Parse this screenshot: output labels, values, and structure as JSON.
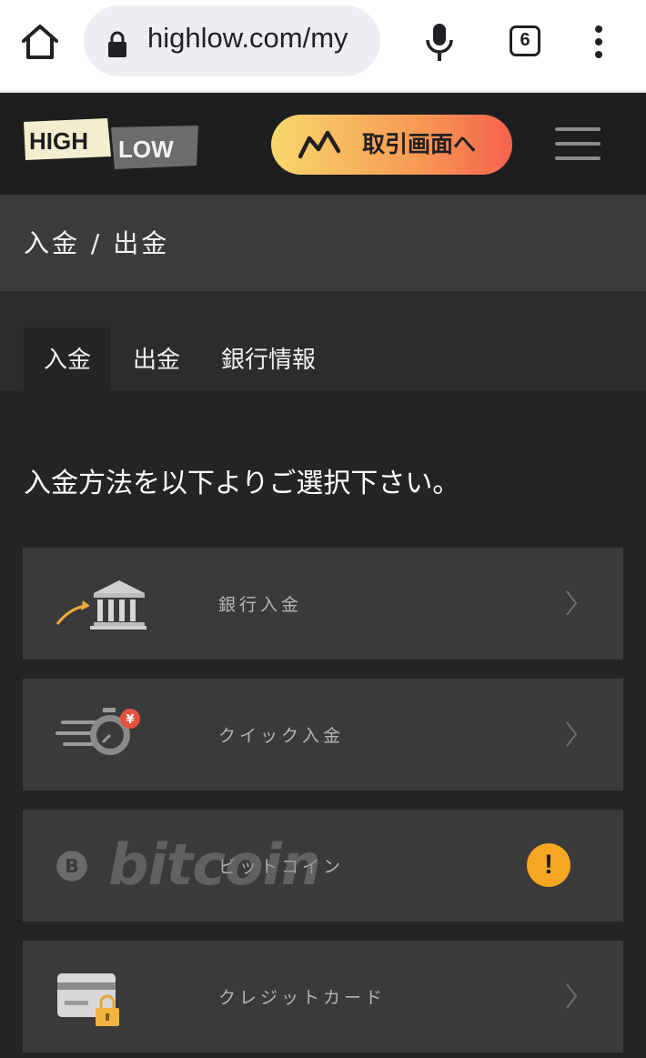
{
  "browser": {
    "url": "highlow.com/my",
    "tab_count": "6"
  },
  "header": {
    "logo_high": "HIGH",
    "logo_low": "LOW",
    "trade_button_label": "取引画面へ"
  },
  "page": {
    "title": "入金 / 出金",
    "tabs": [
      {
        "label": "入金",
        "active": true
      },
      {
        "label": "出金",
        "active": false
      },
      {
        "label": "銀行情報",
        "active": false
      }
    ],
    "instruction": "入金方法を以下よりご選択下さい。"
  },
  "methods": [
    {
      "label": "銀行入金",
      "icon": "bank-icon"
    },
    {
      "label": "クイック入金",
      "icon": "quick-deposit-icon"
    },
    {
      "label": "ビットコイン",
      "icon": "bitcoin-logo",
      "logo_text": "bitcoin",
      "status": "!",
      "disabled": true
    },
    {
      "label": "クレジットカード",
      "icon": "credit-card-icon"
    }
  ],
  "colors": {
    "header_bg": "#1d1e1f",
    "body_bg": "#232425",
    "row_bg": "#3a3a3b",
    "accent_gradient_start": "#f7d86b",
    "accent_gradient_end": "#f5624c",
    "warning": "#f5a623"
  }
}
